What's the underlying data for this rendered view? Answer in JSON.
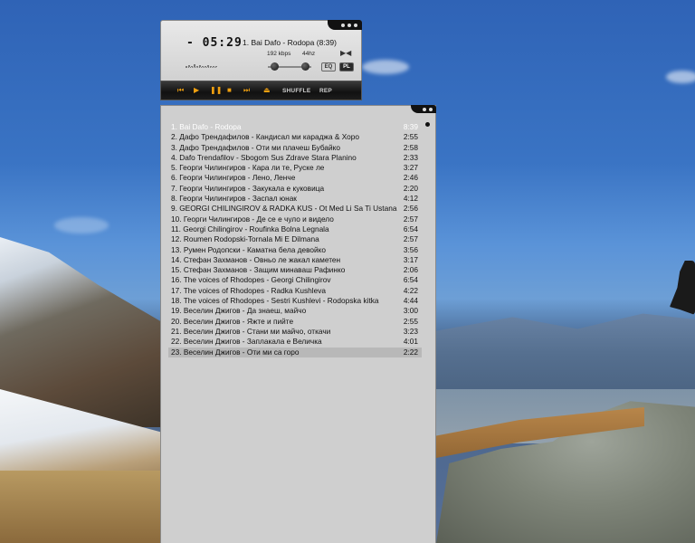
{
  "player": {
    "time": "- 05:29",
    "track_title": "1. Bai Dafo - Rodopa (8:39)",
    "bitrate": "192 kbps",
    "samplerate": "44hz",
    "eq_label": "EQ",
    "pl_label": "PL",
    "shuffle_label": "SHUFFLE",
    "repeat_label": "REP",
    "mono_icon": "stereo-icon",
    "seek_progress": 0.05,
    "volume": 0.1,
    "balance": 0.85
  },
  "colors": {
    "accent": "#f0a010",
    "playlist_bg": "#cfcfcf",
    "selected_row": "#b8b8b8",
    "current_track_text": "#ffffff"
  },
  "playlist": {
    "current_index": 0,
    "selected_index": 22,
    "items": [
      {
        "label": "1. Bai Dafo - Rodopa",
        "duration": "8:39"
      },
      {
        "label": "2. Дафо Трендафилов - Кандисал ми караджа & Хоро",
        "duration": "2:55"
      },
      {
        "label": "3. Дафо Трендафилов - Оти ми плачеш Бубайко",
        "duration": "2:58"
      },
      {
        "label": "4. Dafo Trendafilov - Sbogom Sus Zdrave Stara Planino",
        "duration": "2:33"
      },
      {
        "label": "5. Георги Чилингиров - Кара ли те, Руске ле",
        "duration": "3:27"
      },
      {
        "label": "6. Георги Чилингиров - Лено, Ленче",
        "duration": "2:46"
      },
      {
        "label": "7. Георги Чилингиров - Закукала е куковица",
        "duration": "2:20"
      },
      {
        "label": "8. Георги Чилингиров - Заспал юнак",
        "duration": "4:12"
      },
      {
        "label": "9. GEORGI CHILINGIROV & RADKA KUS - Ot Med Li Sa Ti Ustana",
        "duration": "2:56"
      },
      {
        "label": "10. Георги Чилингиров - Де се е чуло и видело",
        "duration": "2:57"
      },
      {
        "label": "11. Georgi Chilingirov - Roufinka Bolna Legnala",
        "duration": "6:54"
      },
      {
        "label": "12. Roumen Rodopski-Tornala Mi E Dilmana",
        "duration": "2:57"
      },
      {
        "label": "13. Румен Родопски - Каматна бела девойко",
        "duration": "3:56"
      },
      {
        "label": "14. Стефан Захманов - Овньо ле жакал каметен",
        "duration": "3:17"
      },
      {
        "label": "15. Стефан Захманов - Защим минаваш Рафинко",
        "duration": "2:06"
      },
      {
        "label": "16. The voices of Rhodopes - Georgi Chilingirov",
        "duration": "6:54"
      },
      {
        "label": "17. The voices of Rhodopes - Radka Kushleva",
        "duration": "4:22"
      },
      {
        "label": "18. The voices of Rhodopes - Sestri Kushlevi - Rodopska kitka",
        "duration": "4:44"
      },
      {
        "label": "19. Веселин Джигов - Да знаеш, майчо",
        "duration": "3:00"
      },
      {
        "label": "20. Веселин Джигов - Яжте и пийте",
        "duration": "2:55"
      },
      {
        "label": "21. Веселин Джигов - Стани ми майчо, откачи",
        "duration": "3:23"
      },
      {
        "label": "22. Веселин Джигов - Заплакала е Величка",
        "duration": "4:01"
      },
      {
        "label": "23. Веселин Джигов - Оти ми са горо",
        "duration": "2:22"
      }
    ]
  }
}
